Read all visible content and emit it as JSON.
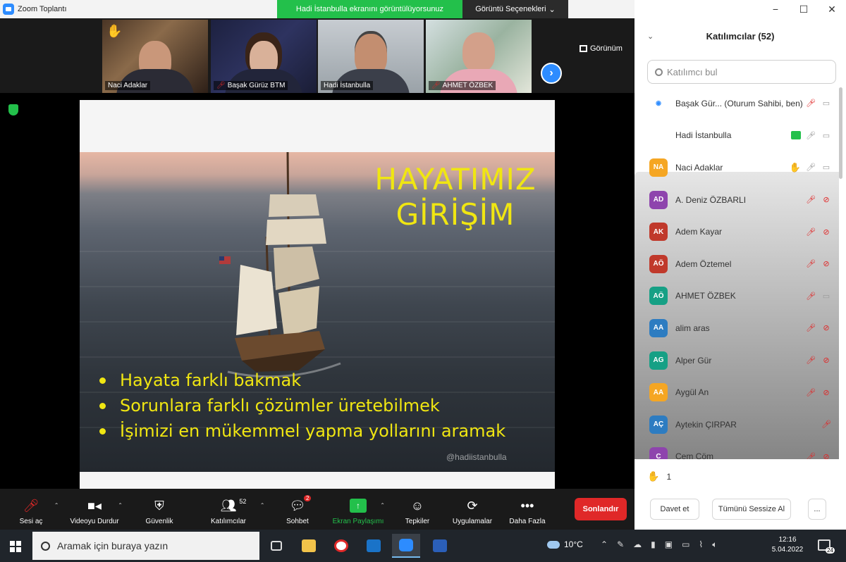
{
  "window": {
    "title": "Zoom Toplantı",
    "share_banner": "Hadi İstanbulla ekranını görüntülüyorsunuz",
    "view_options": "Görüntü Seçenekleri",
    "view_options_icon": "chevron-down-icon",
    "controls": [
      "−",
      "☐",
      "✕"
    ]
  },
  "thumbnails": {
    "items": [
      {
        "name": "Naci Adaklar",
        "muted": false,
        "hand_raised": true
      },
      {
        "name": "Başak Gürüz BTM",
        "muted": true,
        "hand_raised": false
      },
      {
        "name": "Hadi İstanbulla",
        "muted": false,
        "hand_raised": false
      },
      {
        "name": "AHMET ÖZBEK",
        "muted": true,
        "hand_raised": false
      }
    ],
    "next_label": "›",
    "view_label": "Görünüm"
  },
  "slide": {
    "title_line1": "HAYATIMIZ",
    "title_line2": "GİRİŞİM",
    "bullets": [
      "Hayata farklı bakmak",
      "Sorunlara farklı çözümler üretebilmek",
      "İşimizi en mükemmel yapma yollarını aramak"
    ],
    "watermark": "@hadiistanbulla"
  },
  "toolbar": {
    "items": [
      {
        "label": "Sesi aç",
        "icon": "mic-muted-icon"
      },
      {
        "label": "Videoyu Durdur",
        "icon": "video-icon"
      },
      {
        "label": "Güvenlik",
        "icon": "shield-icon"
      },
      {
        "label": "Katılımcılar",
        "icon": "participants-icon",
        "count": "52"
      },
      {
        "label": "Sohbet",
        "icon": "chat-icon",
        "badge": "2"
      },
      {
        "label": "Ekran Paylaşımı",
        "icon": "share-screen-icon"
      },
      {
        "label": "Tepkiler",
        "icon": "reactions-icon"
      },
      {
        "label": "Uygulamalar",
        "icon": "apps-icon"
      },
      {
        "label": "Daha Fazla",
        "icon": "more-icon"
      }
    ],
    "end_label": "Sonlandır"
  },
  "participants_panel": {
    "title": "Katılımcılar (52)",
    "search_placeholder": "Katılımcı bul",
    "participants": [
      {
        "name": "Başak Gür... (Oturum Sahibi, ben)",
        "initials": "",
        "color": "#ffffff",
        "mic": "muted",
        "video": "on"
      },
      {
        "name": "Hadi İstanbulla",
        "initials": "",
        "color": "photo",
        "mic": "on",
        "video": "on",
        "sharing": true
      },
      {
        "name": "Naci Adaklar",
        "initials": "NA",
        "color": "#f5a623",
        "mic": "on",
        "video": "on",
        "hand": true
      },
      {
        "name": "A. Deniz ÖZBARLI",
        "initials": "AD",
        "color": "#8e44ad",
        "mic": "muted",
        "video": "off"
      },
      {
        "name": "Adem Kayar",
        "initials": "AK",
        "color": "#c0392b",
        "mic": "muted",
        "video": "off"
      },
      {
        "name": "Adem Öztemel",
        "initials": "AÖ",
        "color": "#c0392b",
        "mic": "muted",
        "video": "off"
      },
      {
        "name": "AHMET ÖZBEK",
        "initials": "AÖ",
        "color": "#16a085",
        "mic": "muted",
        "video": "on"
      },
      {
        "name": "alim aras",
        "initials": "AA",
        "color": "#2d7cc1",
        "mic": "muted",
        "video": "off"
      },
      {
        "name": "Alper Gür",
        "initials": "AG",
        "color": "#16a085",
        "mic": "muted",
        "video": "off"
      },
      {
        "name": "Aygül An",
        "initials": "AA",
        "color": "#f5a623",
        "mic": "muted",
        "video": "off"
      },
      {
        "name": "Aytekin ÇIRPAR",
        "initials": "AÇ",
        "color": "#2d7cc1",
        "mic": "muted",
        "video": "none"
      },
      {
        "name": "Cem Cöm",
        "initials": "C",
        "color": "#8e44ad",
        "mic": "muted",
        "video": "off"
      }
    ],
    "raised_hands_count": "1",
    "invite_label": "Davet et",
    "mute_all_label": "Tümünü Sessize Al",
    "more_label": "..."
  },
  "taskbar": {
    "search_placeholder": "Aramak için buraya yazın",
    "weather": "10°C",
    "time": "12:16",
    "date": "5.04.2022",
    "notification_count": "24"
  }
}
